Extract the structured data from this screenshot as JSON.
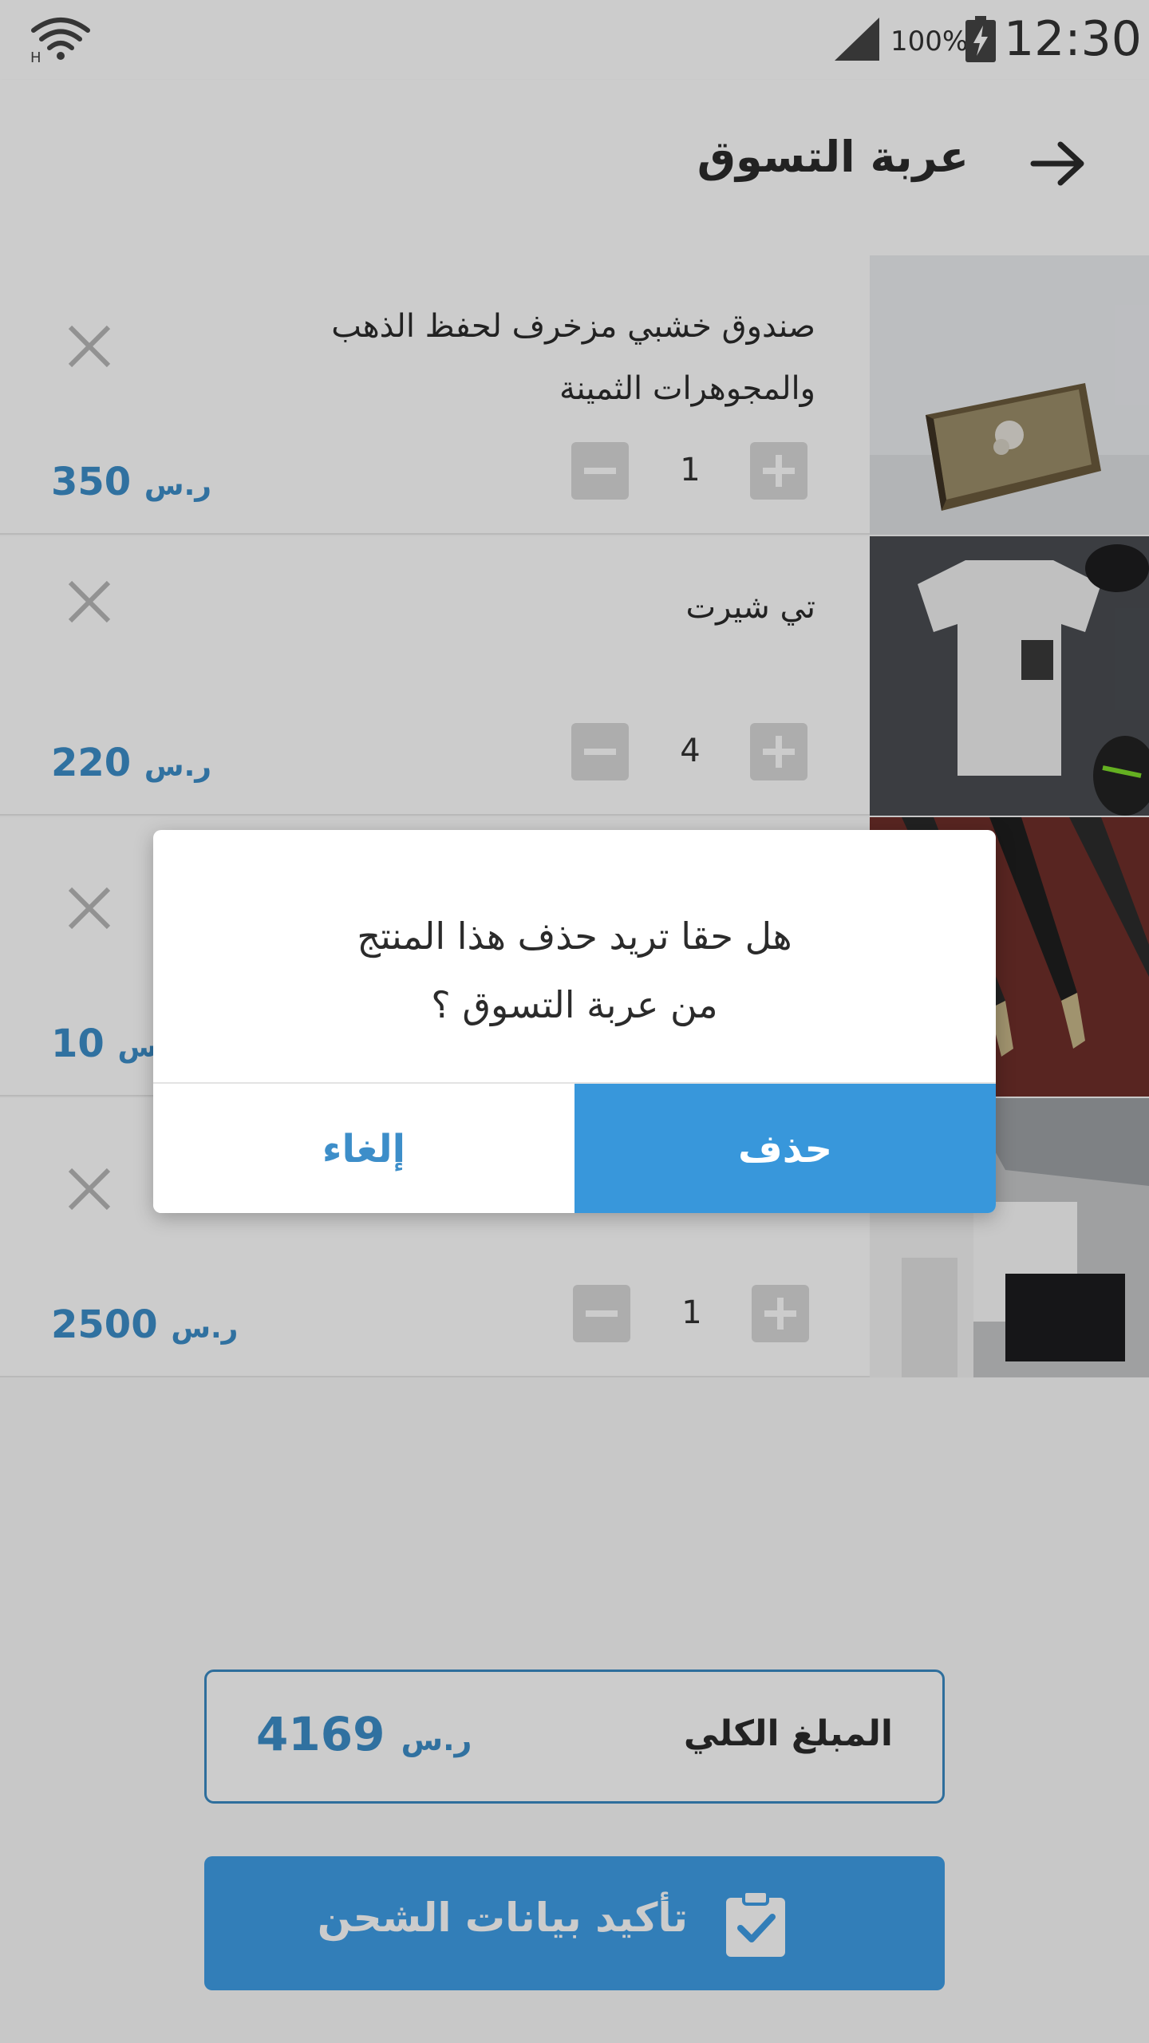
{
  "status_bar": {
    "battery_percent": "100%",
    "time": "12:30"
  },
  "appbar": {
    "title": "عربة التسوق",
    "back_icon": "arrow-right-icon"
  },
  "cart": {
    "items": [
      {
        "name": "صندوق خشبي مزخرف لحفظ الذهب والمجوهرات الثمينة",
        "quantity": "1",
        "price": "350",
        "currency": "ر.س",
        "image": "wooden-jewelry-box"
      },
      {
        "name": "تي شيرت",
        "quantity": "4",
        "price": "220",
        "currency": "ر.س",
        "image": "white-tshirt"
      },
      {
        "name": "",
        "quantity": "",
        "price": "10",
        "currency": "ر.س",
        "image": "fountain-pens"
      },
      {
        "name": "",
        "quantity": "1",
        "price": "2500",
        "currency": "ر.س",
        "image": "apple-products"
      }
    ]
  },
  "total": {
    "label": "المبلغ الكلي",
    "value": "4169",
    "currency": "ر.س"
  },
  "confirm_button": {
    "label": "تأكيد بيانات الشحن",
    "icon": "clipboard-check-icon"
  },
  "dialog": {
    "message_line1": "هل حقا تريد حذف هذا المنتج",
    "message_line2": "من عربة التسوق ؟",
    "delete_label": "حذف",
    "cancel_label": "إلغاء"
  },
  "colors": {
    "accent": "#3897db",
    "price": "#3d8ec9",
    "qty_button": "#d9d9d9"
  }
}
